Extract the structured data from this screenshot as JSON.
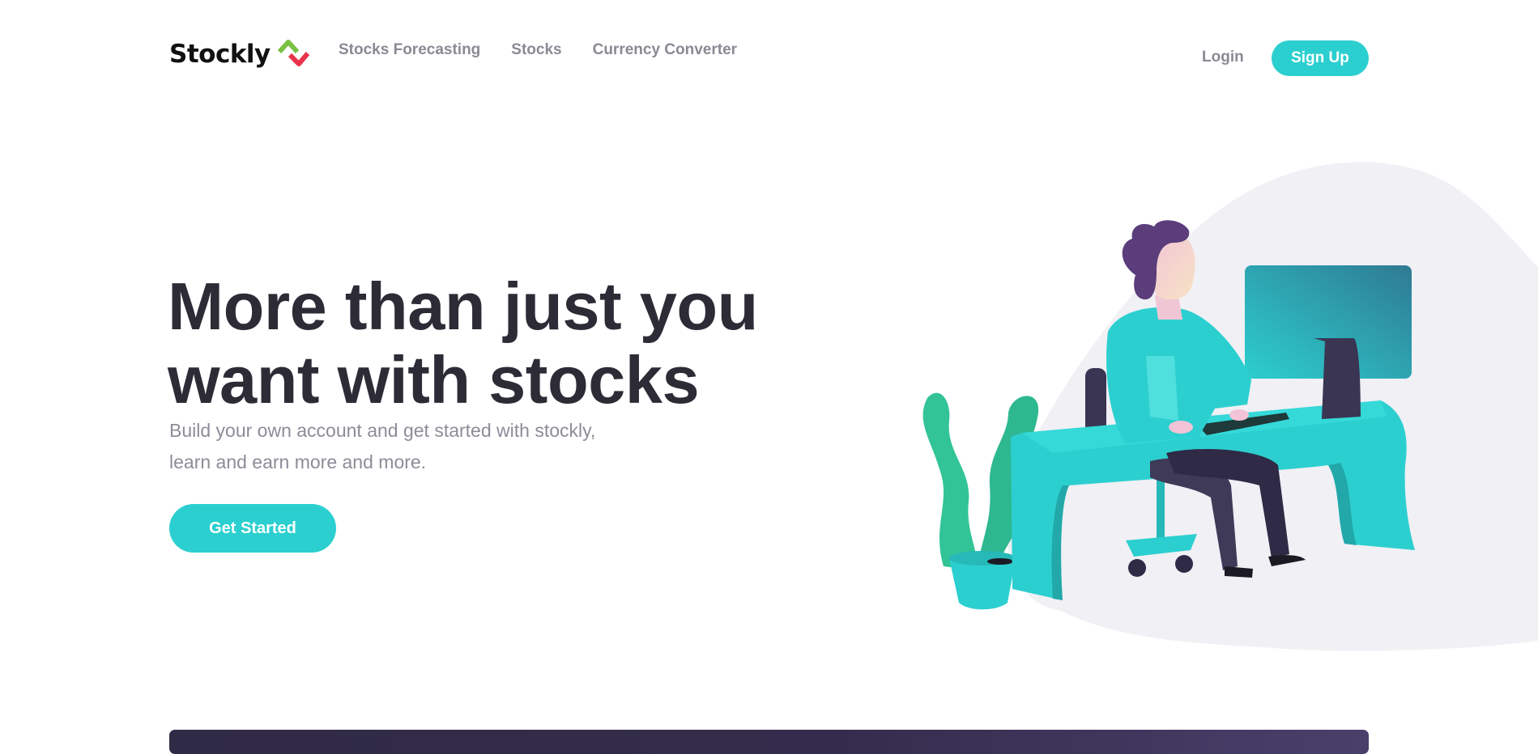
{
  "brand": {
    "name": "Stockly",
    "colors": {
      "accent": "#2ccfcf",
      "logo_green": "#7ac143",
      "logo_red": "#e8324b",
      "heading": "#2d2b36",
      "muted": "#8d8c98"
    }
  },
  "nav": {
    "items": [
      {
        "label": "Stocks Forecasting"
      },
      {
        "label": "Stocks"
      },
      {
        "label": "Currency Converter"
      }
    ],
    "login_label": "Login",
    "signup_label": "Sign Up"
  },
  "hero": {
    "title": "More than just you want with stocks",
    "subtitle_line1": "Build your own account and get started with stockly,",
    "subtitle_line2": "learn and earn more and more.",
    "cta_label": "Get Started"
  },
  "icons": {
    "logo": "stockly-logo-icon",
    "illustration": "person-at-desk-illustration"
  }
}
